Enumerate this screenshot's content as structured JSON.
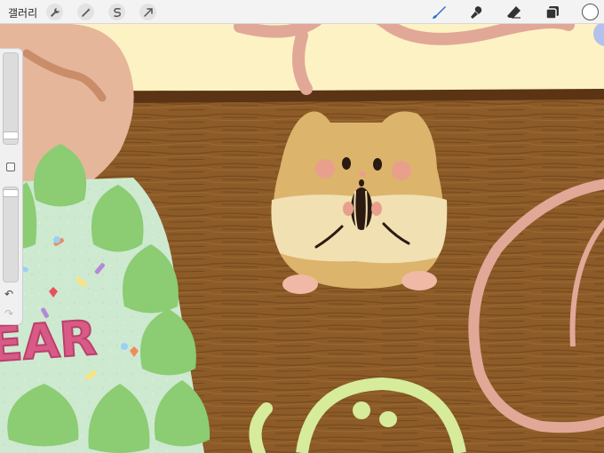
{
  "toolbar": {
    "gallery_label": "갤러리",
    "left_tools": [
      "wrench-icon",
      "magic-wand-icon",
      "selection-icon",
      "move-arrow-icon"
    ],
    "right_tools": [
      "brush-icon",
      "smudge-icon",
      "eraser-icon",
      "layers-icon"
    ],
    "active_tool": "brush",
    "brush_color": "#2a6fc9",
    "current_color": "#ffffff"
  },
  "sidebar": {
    "brush_size_level": 0.9,
    "opacity_level": 0.1,
    "buttons": [
      "modify-square-icon",
      "undo-icon",
      "redo-icon"
    ],
    "undo_glyph": "↶",
    "redo_glyph": "↷"
  },
  "artwork": {
    "cake_text": "EAR",
    "colors": {
      "wall": "#fdf2c4",
      "wood": "#8a5a26",
      "hamster_top": "#dcb46c",
      "hamster_belly": "#f1e0b2",
      "frosting": "#8ccc73",
      "cake_text": "#d95a86",
      "pink_stroke": "#e1a897",
      "lime_stroke": "#d6ec9a"
    }
  }
}
